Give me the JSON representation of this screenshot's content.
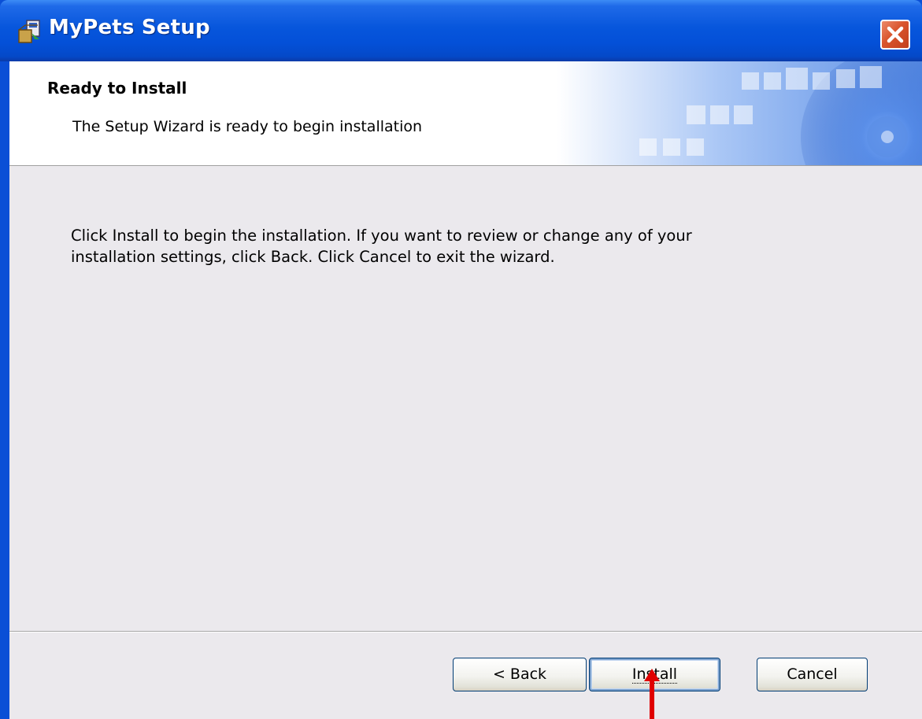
{
  "window": {
    "title": "MyPets Setup"
  },
  "banner": {
    "title": "Ready to Install",
    "subtitle": "The Setup Wizard is ready to begin installation"
  },
  "body": {
    "line1": "Click Install to begin the installation.  If you want to review or change any of your",
    "line2": "installation settings, click Back.  Click Cancel to exit the wizard."
  },
  "buttons": {
    "back": "< Back",
    "install": "Install",
    "cancel": "Cancel"
  },
  "colors": {
    "titlebar": "#0a56dc",
    "close_button": "#d9542c",
    "annotation_arrow": "#e00000",
    "client_background": "#ebe9ed"
  },
  "icons": {
    "app": "setup-installer-icon",
    "close": "close-icon",
    "annotation": "red-arrow-up-icon"
  }
}
